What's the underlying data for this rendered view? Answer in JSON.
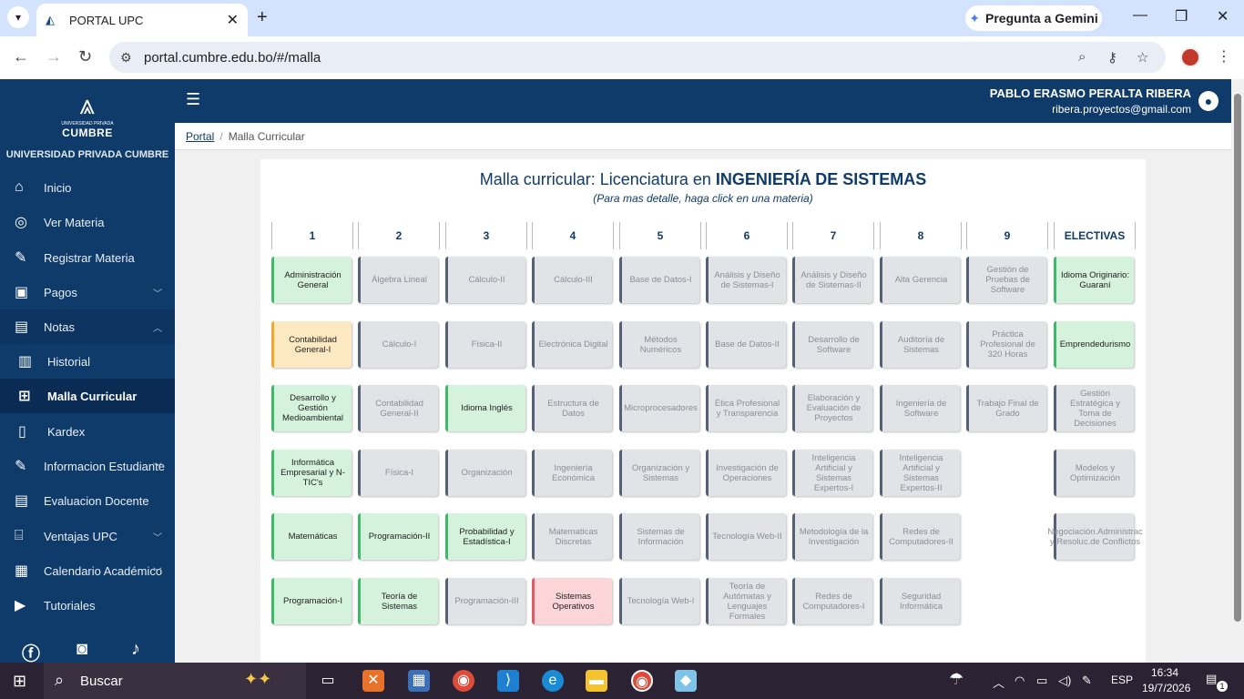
{
  "browser": {
    "tab_title": "PORTAL UPC",
    "gemini_label": "Pregunta a Gemini",
    "url": "portal.cumbre.edu.bo/#/malla"
  },
  "sidebar": {
    "logo_small": "UNIVERSIDAD PRIVADA",
    "logo_brand": "CUMBRE",
    "university": "UNIVERSIDAD PRIVADA CUMBRE",
    "items": [
      {
        "label": "Inicio",
        "icon": "home-icon"
      },
      {
        "label": "Ver Materia",
        "icon": "target-icon"
      },
      {
        "label": "Registrar Materia",
        "icon": "edit-icon"
      },
      {
        "label": "Pagos",
        "icon": "money-icon"
      },
      {
        "label": "Notas",
        "icon": "clipboard-icon"
      },
      {
        "label": "Historial",
        "icon": "book-icon"
      },
      {
        "label": "Malla Curricular",
        "icon": "grid-icon"
      },
      {
        "label": "Kardex",
        "icon": "document-icon"
      },
      {
        "label": "Informacion Estudiante",
        "icon": "edit-icon"
      },
      {
        "label": "Evaluacion Docente",
        "icon": "clipboard-icon"
      },
      {
        "label": "Ventajas UPC",
        "icon": "building-icon"
      },
      {
        "label": "Calendario Académico",
        "icon": "calendar-icon"
      },
      {
        "label": "Tutoriales",
        "icon": "video-icon"
      }
    ]
  },
  "header": {
    "user_name": "PABLO ERASMO PERALTA RIBERA",
    "user_email": "ribera.proyectos@gmail.com"
  },
  "breadcrumb": {
    "root": "Portal",
    "current": "Malla Curricular"
  },
  "page": {
    "title_prefix": "Malla curricular: Licenciatura en ",
    "title_bold": "INGENIERÍA DE SISTEMAS",
    "subtitle": "(Para mas detalle, haga click en una materia)"
  },
  "status_colors": {
    "approved": "#3fb86a",
    "pending": "#566077",
    "current": "#f0a830",
    "failed": "#e05b63"
  },
  "columns": [
    {
      "label": "1",
      "courses": [
        {
          "name": "Administración General",
          "status": "approved"
        },
        {
          "name": "Contabilidad General-I",
          "status": "current"
        },
        {
          "name": "Desarrollo y Gestión Medioambiental",
          "status": "approved"
        },
        {
          "name": "Informática Empresarial y N-TIC's",
          "status": "approved"
        },
        {
          "name": "Matemáticas",
          "status": "approved"
        },
        {
          "name": "Programación-I",
          "status": "approved"
        }
      ]
    },
    {
      "label": "2",
      "courses": [
        {
          "name": "Álgebra Lineal",
          "status": "pending"
        },
        {
          "name": "Cálculo-I",
          "status": "pending"
        },
        {
          "name": "Contabilidad General-II",
          "status": "pending"
        },
        {
          "name": "Física-I",
          "status": "pending"
        },
        {
          "name": "Programación-II",
          "status": "approved"
        },
        {
          "name": "Teoría de Sistemas",
          "status": "approved"
        }
      ]
    },
    {
      "label": "3",
      "courses": [
        {
          "name": "Cálculo-II",
          "status": "pending"
        },
        {
          "name": "Física-II",
          "status": "pending"
        },
        {
          "name": "Idioma Inglés",
          "status": "approved"
        },
        {
          "name": "Organización",
          "status": "pending"
        },
        {
          "name": "Probabilidad y Estadística-I",
          "status": "approved"
        },
        {
          "name": "Programación-III",
          "status": "pending"
        }
      ]
    },
    {
      "label": "4",
      "courses": [
        {
          "name": "Cálculo-III",
          "status": "pending"
        },
        {
          "name": "Electrónica Digital",
          "status": "pending"
        },
        {
          "name": "Estructura de Datos",
          "status": "pending"
        },
        {
          "name": "Ingeniería Económica",
          "status": "pending"
        },
        {
          "name": "Matematicas Discretas",
          "status": "pending"
        },
        {
          "name": "Sistemas Operativos",
          "status": "failed"
        }
      ]
    },
    {
      "label": "5",
      "courses": [
        {
          "name": "Base de Datos-I",
          "status": "pending"
        },
        {
          "name": "Métodos Numéricos",
          "status": "pending"
        },
        {
          "name": "Microprocesadores",
          "status": "pending"
        },
        {
          "name": "Organización y Sistemas",
          "status": "pending"
        },
        {
          "name": "Sistemas de Información",
          "status": "pending"
        },
        {
          "name": "Tecnología Web-I",
          "status": "pending"
        }
      ]
    },
    {
      "label": "6",
      "courses": [
        {
          "name": "Análisis y Diseño de Sistemas-I",
          "status": "pending"
        },
        {
          "name": "Base de Datos-II",
          "status": "pending"
        },
        {
          "name": "Ética Profesional y Transparencia",
          "status": "pending"
        },
        {
          "name": "Investigación de Operaciones",
          "status": "pending"
        },
        {
          "name": "Tecnología Web-II",
          "status": "pending"
        },
        {
          "name": "Teoría de Autómatas y Lenguajes Formales",
          "status": "pending"
        }
      ]
    },
    {
      "label": "7",
      "courses": [
        {
          "name": "Análisis y Diseño de Sistemas-II",
          "status": "pending"
        },
        {
          "name": "Desarrollo de Software",
          "status": "pending"
        },
        {
          "name": "Elaboración y Evaluación de Proyectos",
          "status": "pending"
        },
        {
          "name": "Inteligencia Artificial y Sistemas Expertos-I",
          "status": "pending"
        },
        {
          "name": "Metodología de la Investigación",
          "status": "pending"
        },
        {
          "name": "Redes de Computadores-I",
          "status": "pending"
        }
      ]
    },
    {
      "label": "8",
      "courses": [
        {
          "name": "Alta Gerencia",
          "status": "pending"
        },
        {
          "name": "Auditoría de Sistemas",
          "status": "pending"
        },
        {
          "name": "Ingeniería de Software",
          "status": "pending"
        },
        {
          "name": "Inteligencia Artificial y Sistemas Expertos-II",
          "status": "pending"
        },
        {
          "name": "Redes de Computadores-II",
          "status": "pending"
        },
        {
          "name": "Seguridad Informática",
          "status": "pending"
        }
      ]
    },
    {
      "label": "9",
      "courses": [
        {
          "name": "Gestión de Pruebas de Software",
          "status": "pending"
        },
        {
          "name": "Práctica Profesional de 320 Horas",
          "status": "pending"
        },
        {
          "name": "Trabajo Final de Grado",
          "status": "pending"
        }
      ]
    },
    {
      "label": "ELECTIVAS",
      "courses": [
        {
          "name": "Idioma Originario: Guaraní",
          "status": "approved"
        },
        {
          "name": "Emprendedurismo",
          "status": "approved"
        },
        {
          "name": "Gestión Estratégica y Toma de Decisiones",
          "status": "pending"
        },
        {
          "name": "Modelos y Optimización",
          "status": "pending"
        },
        {
          "name": "Negociación.Administrac y Resoluc.de Conflictos",
          "status": "pending"
        }
      ]
    }
  ],
  "taskbar": {
    "search_label": "Buscar",
    "language": "ESP",
    "time": "16:34",
    "date": "19/7/2026",
    "notifications": "1"
  }
}
